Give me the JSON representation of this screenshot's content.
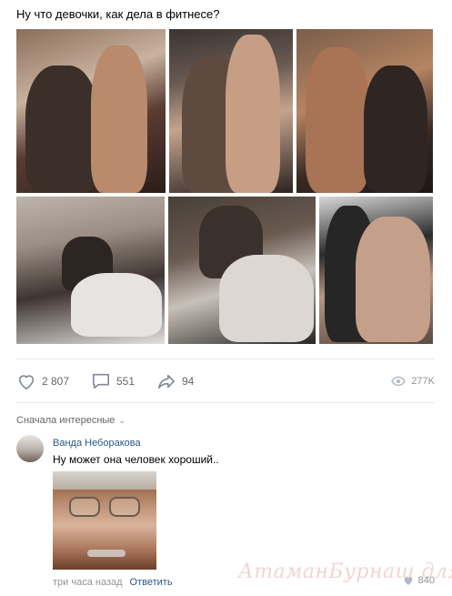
{
  "post": {
    "text": "Ну что девочки, как дела в фитнесе?"
  },
  "actions": {
    "likes": "2 807",
    "comments": "551",
    "shares": "94",
    "views": "277K"
  },
  "comments": {
    "sort_label": "Сначала интересные",
    "items": [
      {
        "author": "Ванда Небоpакова",
        "text": "Ну может она человек хороший..",
        "time": "три часа назад",
        "reply_label": "Ответить",
        "likes": "840"
      }
    ]
  },
  "watermark": "АтаманБурнаш для ЯП",
  "colors": {
    "link": "#2a5885",
    "muted": "#939393",
    "icon": "#656565",
    "divider": "#e7e8ec"
  }
}
